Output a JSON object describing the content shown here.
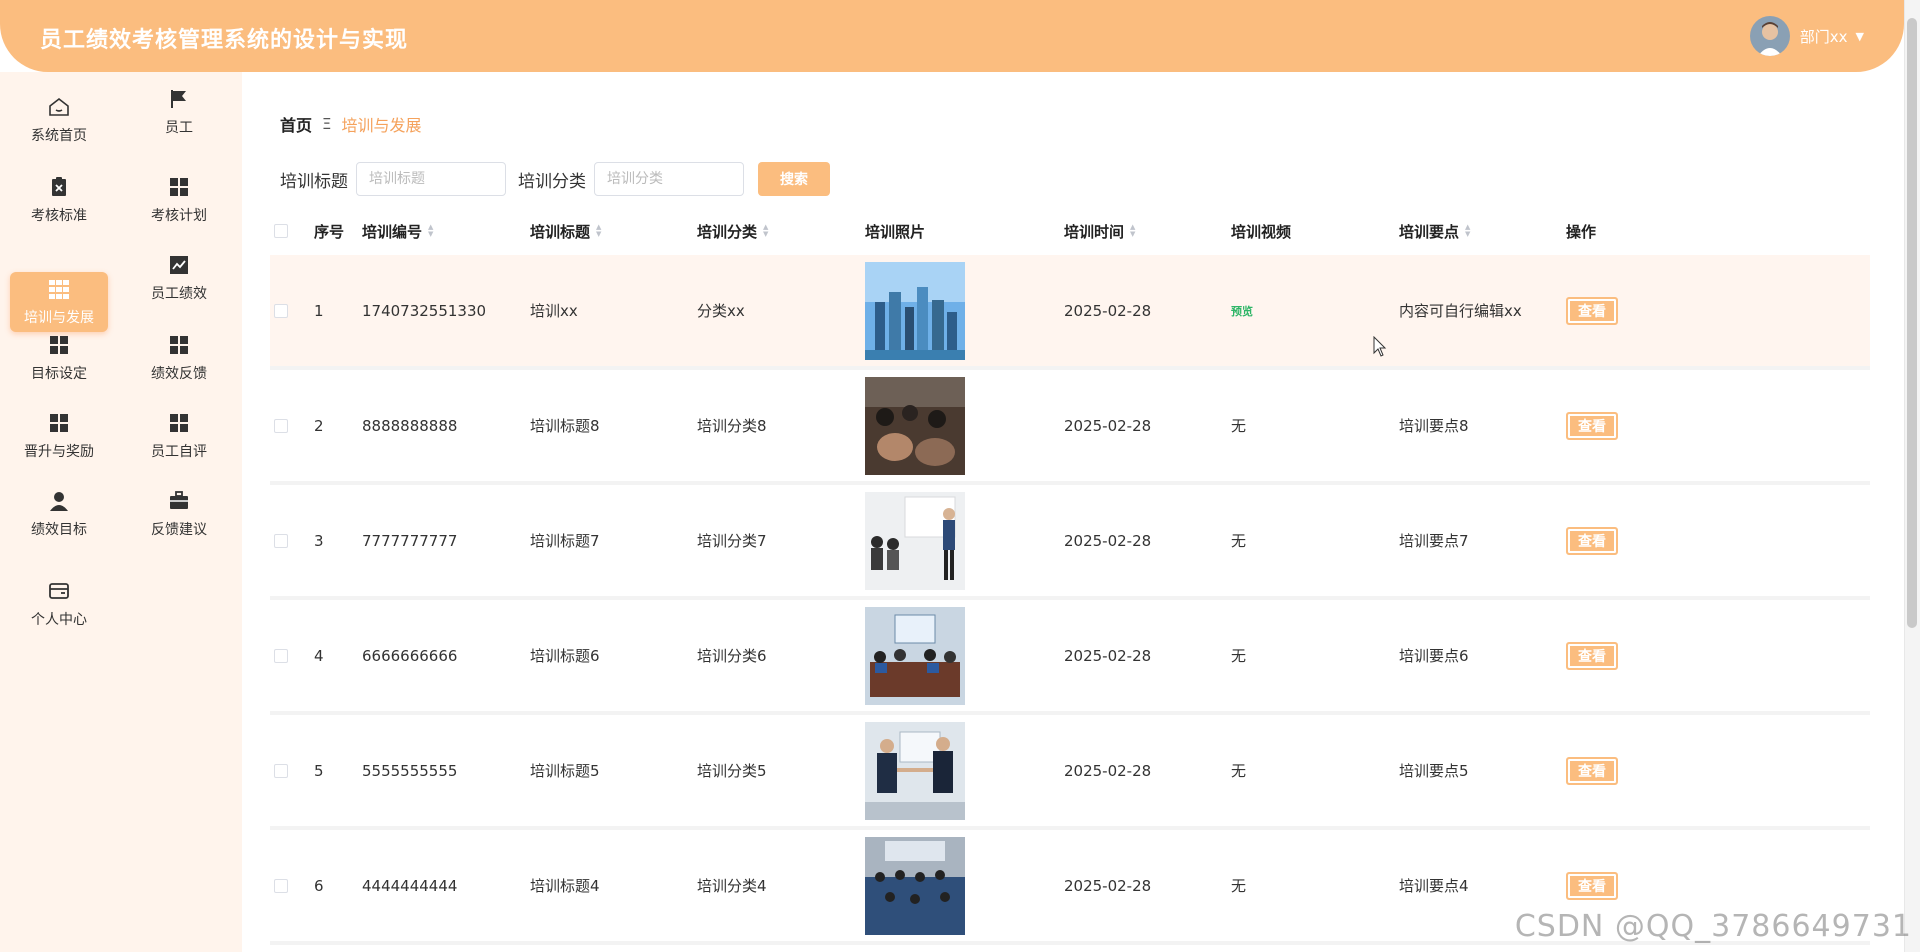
{
  "header": {
    "title": "员工绩效考核管理系统的设计与实现",
    "user_name": "部门xx"
  },
  "sidebar": {
    "items": [
      {
        "label": "系统首页",
        "icon": "home-icon"
      },
      {
        "label": "员工",
        "icon": "flag-icon"
      },
      {
        "label": "考核标准",
        "icon": "clipboard-x-icon"
      },
      {
        "label": "考核计划",
        "icon": "grid-icon"
      },
      {
        "label": "培训与发展",
        "icon": "grid-9-icon",
        "active": true
      },
      {
        "label": "员工绩效",
        "icon": "chart-line-icon"
      },
      {
        "label": "目标设定",
        "icon": "grid-icon"
      },
      {
        "label": "绩效反馈",
        "icon": "grid-icon"
      },
      {
        "label": "晋升与奖励",
        "icon": "grid-icon"
      },
      {
        "label": "员工自评",
        "icon": "grid-icon"
      },
      {
        "label": "绩效目标",
        "icon": "user-icon"
      },
      {
        "label": "反馈建议",
        "icon": "briefcase-icon"
      },
      {
        "label": "个人中心",
        "icon": "card-icon"
      }
    ]
  },
  "breadcrumb": {
    "home": "首页",
    "separator": "Ξ",
    "current": "培训与发展"
  },
  "search": {
    "title_label": "培训标题",
    "title_placeholder": "培训标题",
    "category_label": "培训分类",
    "category_placeholder": "培训分类",
    "button": "搜索"
  },
  "table": {
    "headers": {
      "index": "序号",
      "number": "培训编号",
      "title": "培训标题",
      "category": "培训分类",
      "photo": "培训照片",
      "time": "培训时间",
      "video": "培训视频",
      "key_points": "培训要点",
      "action": "操作"
    },
    "rows": [
      {
        "index": "1",
        "number": "1740732551330",
        "title": "培训xx",
        "category": "分类xx",
        "time": "2025-02-28",
        "video": "预览",
        "key_points": "内容可自行编辑xx",
        "action": "查看"
      },
      {
        "index": "2",
        "number": "8888888888",
        "title": "培训标题8",
        "category": "培训分类8",
        "time": "2025-02-28",
        "video": "无",
        "key_points": "培训要点8",
        "action": "查看"
      },
      {
        "index": "3",
        "number": "7777777777",
        "title": "培训标题7",
        "category": "培训分类7",
        "time": "2025-02-28",
        "video": "无",
        "key_points": "培训要点7",
        "action": "查看"
      },
      {
        "index": "4",
        "number": "6666666666",
        "title": "培训标题6",
        "category": "培训分类6",
        "time": "2025-02-28",
        "video": "无",
        "key_points": "培训要点6",
        "action": "查看"
      },
      {
        "index": "5",
        "number": "5555555555",
        "title": "培训标题5",
        "category": "培训分类5",
        "time": "2025-02-28",
        "video": "无",
        "key_points": "培训要点5",
        "action": "查看"
      },
      {
        "index": "6",
        "number": "4444444444",
        "title": "培训标题4",
        "category": "培训分类4",
        "time": "2025-02-28",
        "video": "无",
        "key_points": "培训要点4",
        "action": "查看"
      }
    ]
  },
  "watermark": "CSDN @QQ_3786649731",
  "colors": {
    "accent": "#fbbd7f",
    "sidebar_bg": "#fff4ec",
    "highlight_row": "#fff5ef",
    "preview_text": "#2fb567"
  }
}
